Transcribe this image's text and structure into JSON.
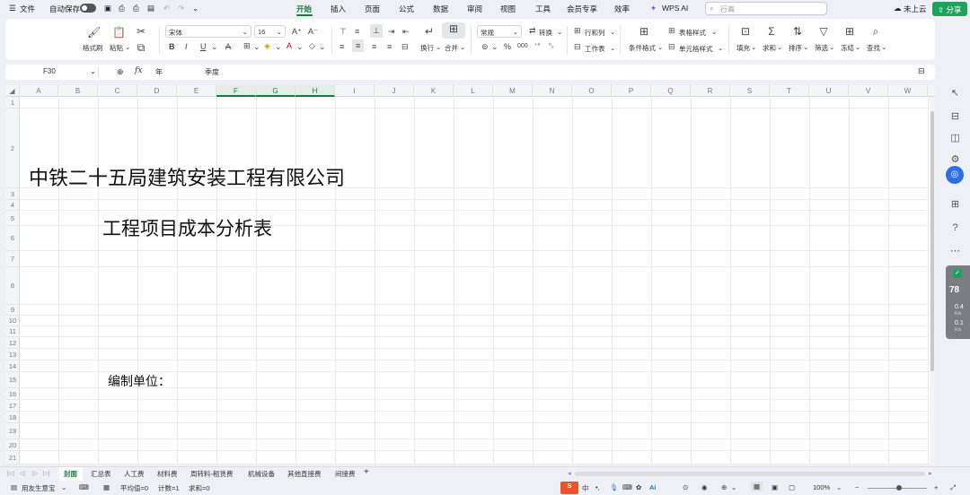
{
  "menubar": {
    "menu_icon": "hamburger-icon",
    "file": "文件",
    "autosave": "自动保存",
    "tabs": [
      "开始",
      "插入",
      "页面",
      "公式",
      "数据",
      "审阅",
      "视图",
      "工具",
      "会员专享",
      "效率"
    ],
    "active_tab": "开始",
    "wps_ai": "WPS AI",
    "search_placeholder": "行高",
    "cloud": "未上云",
    "share": "分享"
  },
  "ribbon": {
    "format_painter": "格式刷",
    "paste": "粘贴",
    "font_name": "宋体",
    "font_size": "16",
    "wrap": "换行",
    "merge": "合并",
    "number_format": "常规",
    "convert": "转换",
    "row_col": "行和列",
    "worksheet": "工作表",
    "cond_format": "条件格式",
    "table_style": "表格样式",
    "cell_style": "单元格样式",
    "fill": "填充",
    "sum": "求和",
    "sort": "排序",
    "filter": "筛选",
    "freeze": "冻结",
    "find": "查找",
    "percent": "%",
    "thousands": "000"
  },
  "formulabar": {
    "cell_ref": "F30",
    "fx": "fx",
    "formula_a": "年",
    "formula_b": "季度"
  },
  "columns": [
    "A",
    "B",
    "C",
    "D",
    "E",
    "F",
    "G",
    "H",
    "I",
    "J",
    "K",
    "L",
    "M",
    "N",
    "O",
    "P",
    "Q",
    "R",
    "S",
    "T",
    "U",
    "V",
    "W"
  ],
  "rows": [
    "1",
    "2",
    "3",
    "4",
    "5",
    "6",
    "7",
    "8",
    "9",
    "10",
    "11",
    "12",
    "13",
    "14",
    "15",
    "16",
    "17",
    "18",
    "19",
    "20",
    "21"
  ],
  "cells": {
    "company": "中铁二十五局建筑安装工程有限公司",
    "title": "工程项目成本分析表",
    "compiler": "编制单位："
  },
  "perf": {
    "score": "78",
    "up": "0.4",
    "down": "0.1",
    "unit": "K/s"
  },
  "sheet_tabs": [
    "封面",
    "汇总表",
    "人工费",
    "材料费",
    "周转料-租赁费",
    "机械设备",
    "其他直接费",
    "间接费"
  ],
  "active_sheet": "封面",
  "status": {
    "doc_helper": "用友生意宝",
    "average": "平均值=0",
    "count": "计数=1",
    "sum": "求和=0",
    "zoom": "100%"
  },
  "colors": {
    "accent": "#1a7a3e",
    "share": "#1fa35c"
  }
}
